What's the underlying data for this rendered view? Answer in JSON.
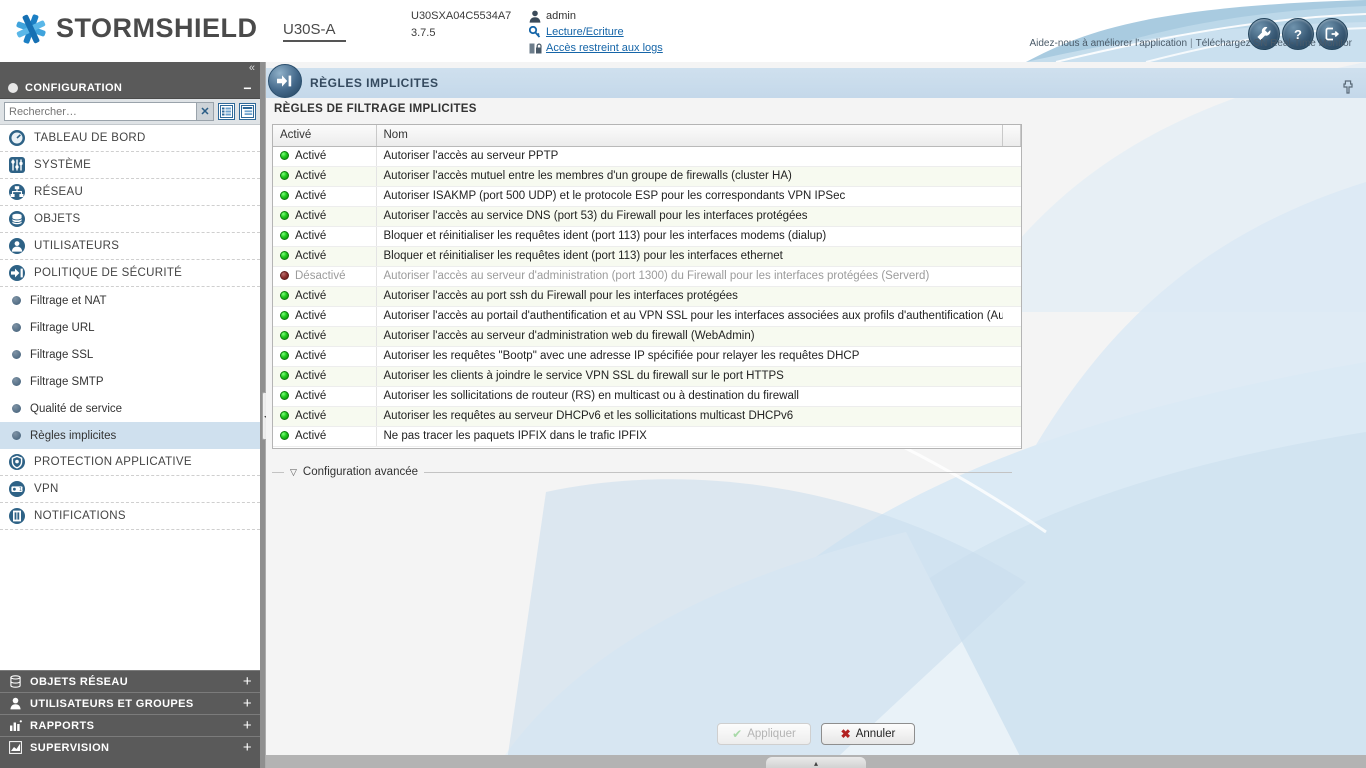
{
  "header": {
    "brand": "STORMSHIELD",
    "device_name": "U30S-A",
    "serial": "U30SXA04C5534A7",
    "version": "3.7.5",
    "user_name": "admin",
    "rights_link": "Lecture/Ecriture",
    "logs_link": "Accès restreint aux logs",
    "tagline_left": "Aidez-nous à améliorer l'application",
    "tagline_sep": "|",
    "tagline_right": "Téléchargez SN Real-Time Monitor",
    "icons": {
      "logo": "stormshield-logo-icon",
      "user": "user-icon",
      "key": "key-icon",
      "lock": "lock-logs-icon",
      "tools": "tools-icon",
      "help": "help-icon",
      "logout": "logout-icon"
    }
  },
  "sidebar": {
    "collapse_glyph": "«",
    "title": "CONFIGURATION",
    "minus_glyph": "−",
    "search": {
      "placeholder": "Rechercher…",
      "value": "",
      "clear_glyph": "✕",
      "view_list_name": "view-list-icon",
      "view_tree_name": "view-tree-icon"
    },
    "items": [
      {
        "label": "TABLEAU DE BORD",
        "type": "top",
        "icon": "dashboard-icon"
      },
      {
        "label": "SYSTÈME",
        "type": "top",
        "icon": "system-icon"
      },
      {
        "label": "RÉSEAU",
        "type": "top",
        "icon": "network-icon"
      },
      {
        "label": "OBJETS",
        "type": "top",
        "icon": "objects-icon"
      },
      {
        "label": "UTILISATEURS",
        "type": "top",
        "icon": "users-icon"
      },
      {
        "label": "POLITIQUE DE SÉCURITÉ",
        "type": "top",
        "icon": "security-policy-icon"
      },
      {
        "label": "Filtrage et NAT",
        "type": "sub",
        "active": false
      },
      {
        "label": "Filtrage URL",
        "type": "sub",
        "active": false
      },
      {
        "label": "Filtrage SSL",
        "type": "sub",
        "active": false
      },
      {
        "label": "Filtrage SMTP",
        "type": "sub",
        "active": false
      },
      {
        "label": "Qualité de service",
        "type": "sub",
        "active": false
      },
      {
        "label": "Règles implicites",
        "type": "sub",
        "active": true
      },
      {
        "label": "PROTECTION APPLICATIVE",
        "type": "top",
        "icon": "shield-icon"
      },
      {
        "label": "VPN",
        "type": "top",
        "icon": "vpn-icon"
      },
      {
        "label": "NOTIFICATIONS",
        "type": "top",
        "icon": "notifications-icon"
      }
    ],
    "groups": [
      {
        "label": "OBJETS RÉSEAU",
        "icon": "objects-db-icon",
        "expand": "+"
      },
      {
        "label": "UTILISATEURS ET GROUPES",
        "icon": "user-group-icon",
        "expand": "+"
      },
      {
        "label": "RAPPORTS",
        "icon": "reports-icon",
        "expand": "+"
      },
      {
        "label": "SUPERVISION",
        "icon": "supervision-icon",
        "expand": "+"
      }
    ]
  },
  "splitter": {
    "grip_glyph": "◄"
  },
  "main": {
    "page_title": "RÈGLES IMPLICITES",
    "page_title_icon": "implicit-rules-icon",
    "pin_icon": "pin-icon",
    "section_label": "RÈGLES DE FILTRAGE IMPLICITES",
    "table": {
      "columns": [
        "Activé",
        "Nom"
      ],
      "rows": [
        {
          "state": "Activé",
          "enabled": true,
          "name": "Autoriser l'accès au serveur PPTP"
        },
        {
          "state": "Activé",
          "enabled": true,
          "name": "Autoriser l'accès mutuel entre les membres d'un groupe de firewalls (cluster HA)"
        },
        {
          "state": "Activé",
          "enabled": true,
          "name": "Autoriser ISAKMP (port 500 UDP) et le protocole ESP pour les correspondants VPN IPSec"
        },
        {
          "state": "Activé",
          "enabled": true,
          "name": "Autoriser l'accès au service DNS (port 53) du Firewall pour les interfaces protégées"
        },
        {
          "state": "Activé",
          "enabled": true,
          "name": "Bloquer et réinitialiser les requêtes ident (port 113) pour les interfaces modems (dialup)"
        },
        {
          "state": "Activé",
          "enabled": true,
          "name": "Bloquer et réinitialiser les requêtes ident (port 113) pour les interfaces ethernet"
        },
        {
          "state": "Désactivé",
          "enabled": false,
          "name": "Autoriser l'accès au serveur d'administration (port 1300) du Firewall pour les interfaces protégées (Serverd)"
        },
        {
          "state": "Activé",
          "enabled": true,
          "name": "Autoriser l'accès au port ssh du Firewall pour les interfaces protégées"
        },
        {
          "state": "Activé",
          "enabled": true,
          "name": "Autoriser l'accès au portail d'authentification et au VPN SSL pour les interfaces associées aux profils d'authentification (Authd)"
        },
        {
          "state": "Activé",
          "enabled": true,
          "name": "Autoriser l'accès au serveur d'administration web du firewall (WebAdmin)"
        },
        {
          "state": "Activé",
          "enabled": true,
          "name": "Autoriser les requêtes \"Bootp\" avec une adresse IP spécifiée pour relayer les requêtes DHCP"
        },
        {
          "state": "Activé",
          "enabled": true,
          "name": "Autoriser les clients à joindre le service VPN SSL du firewall sur le port HTTPS"
        },
        {
          "state": "Activé",
          "enabled": true,
          "name": "Autoriser les sollicitations de routeur (RS) en multicast ou à destination du firewall"
        },
        {
          "state": "Activé",
          "enabled": true,
          "name": "Autoriser les requêtes au serveur DHCPv6 et les sollicitations multicast DHCPv6"
        },
        {
          "state": "Activé",
          "enabled": true,
          "name": "Ne pas tracer les paquets IPFIX dans le trafic IPFIX"
        }
      ]
    },
    "advanced": {
      "label": "Configuration avancée",
      "caret": "▽"
    },
    "buttons": {
      "apply": "Appliquer",
      "apply_icon": "check-icon",
      "cancel": "Annuler",
      "cancel_icon": "cross-icon"
    }
  },
  "colors": {
    "accent": "#1565a8",
    "sidebar_dark": "#5a5a5a",
    "title_band": "#cfe0ee",
    "led_on": "#1ec81e",
    "led_off": "#8e2f2f",
    "row_alt": "#f7faf0"
  }
}
